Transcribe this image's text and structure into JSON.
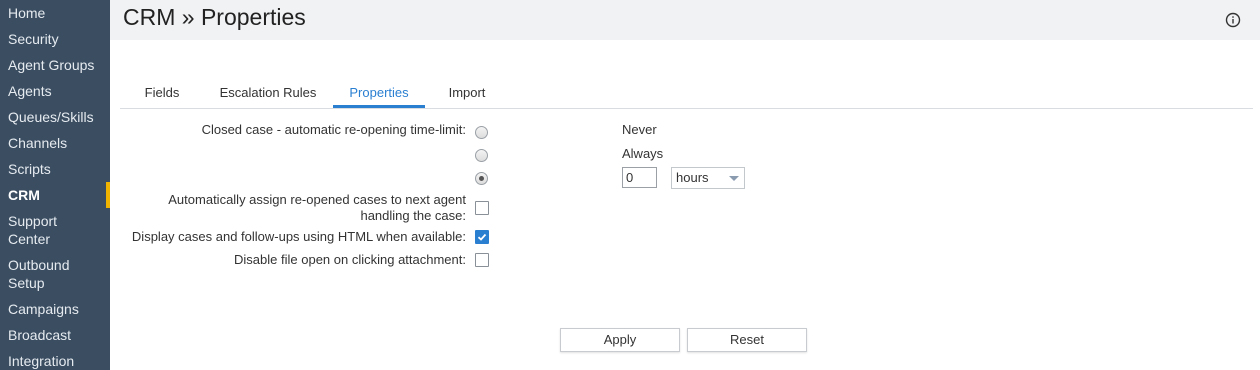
{
  "sidebar": {
    "items": [
      {
        "label": "Home"
      },
      {
        "label": "Security"
      },
      {
        "label": "Agent Groups"
      },
      {
        "label": "Agents"
      },
      {
        "label": "Queues/Skills"
      },
      {
        "label": "Channels"
      },
      {
        "label": "Scripts"
      },
      {
        "label": "CRM",
        "active": true
      },
      {
        "label": "Support Center"
      },
      {
        "label": "Outbound Setup"
      },
      {
        "label": "Campaigns"
      },
      {
        "label": "Broadcast"
      },
      {
        "label": "Integration"
      }
    ]
  },
  "header": {
    "title": "CRM » Properties",
    "info_icon": "info-circle-icon"
  },
  "tabs": [
    {
      "label": "Fields"
    },
    {
      "label": "Escalation Rules"
    },
    {
      "label": "Properties",
      "active": true
    },
    {
      "label": "Import"
    }
  ],
  "form": {
    "reopen_label": "Closed case - automatic re-opening time-limit:",
    "reopen_options": [
      {
        "label": "Never",
        "selected": false
      },
      {
        "label": "Always",
        "selected": false
      },
      {
        "label": "",
        "selected": true
      }
    ],
    "reopen_value": "0",
    "reopen_unit": "hours",
    "auto_assign_label_line1": "Automatically assign re-opened cases to next agent",
    "auto_assign_label_line2": "handling the case:",
    "auto_assign_checked": false,
    "html_display_label": "Display cases and follow-ups using HTML when available:",
    "html_display_checked": true,
    "disable_file_open_label": "Disable file open on clicking attachment:",
    "disable_file_open_checked": false
  },
  "buttons": {
    "apply": "Apply",
    "reset": "Reset"
  },
  "colors": {
    "sidebar_bg": "#3a4d61",
    "active_marker": "#f0b400",
    "accent": "#2a7fd1"
  }
}
